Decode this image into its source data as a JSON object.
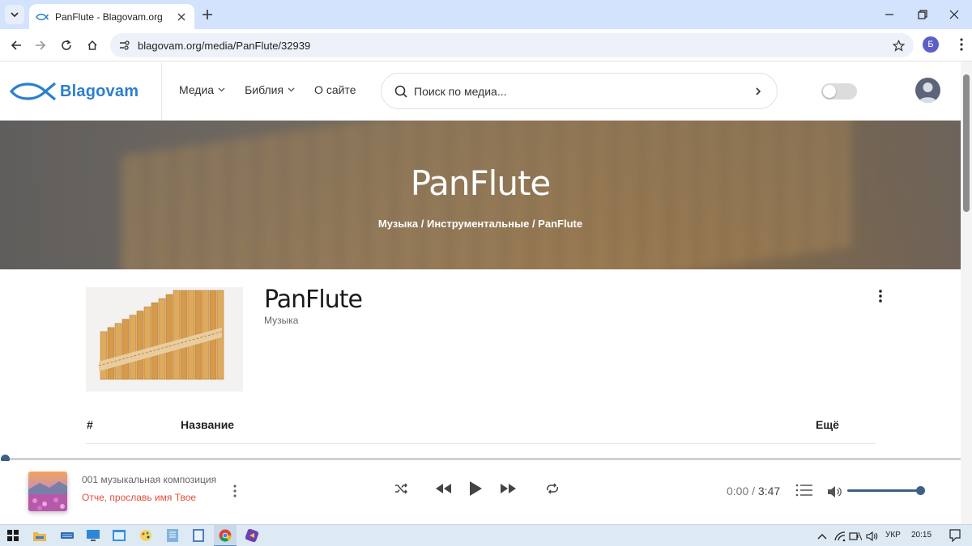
{
  "browser": {
    "tab_title": "PanFlute - Blagovam.org",
    "url": "blagovam.org/media/PanFlute/32939",
    "profile_initial": "Б"
  },
  "site": {
    "logo_text": "Blagovam",
    "nav": [
      {
        "label": "Медиа",
        "has_dropdown": true
      },
      {
        "label": "Библия",
        "has_dropdown": true
      },
      {
        "label": "О сайте",
        "has_dropdown": false
      }
    ],
    "search_placeholder": "Поиск по медиа...",
    "theme_toggle_on": false
  },
  "hero": {
    "title": "PanFlute",
    "breadcrumb": [
      "Музыка",
      "Инструментальные",
      "PanFlute"
    ],
    "breadcrumb_sep": " / "
  },
  "album": {
    "title": "PanFlute",
    "category": "Музыка"
  },
  "table": {
    "headers": {
      "num": "#",
      "name": "Название",
      "more": "Ещё"
    }
  },
  "player": {
    "track_title": "001 музыкальная композиция",
    "track_artist": "Отче, прославь имя Твое",
    "current_time": "0:00",
    "time_sep": " / ",
    "duration": "3:47",
    "progress_fraction": 0,
    "volume_fraction": 1.0,
    "accent_color": "#3e5f86",
    "artist_color": "#e74c3c"
  },
  "taskbar": {
    "language": "УКР",
    "clock": "20:15"
  },
  "colors": {
    "brand_blue": "#2a7fcf",
    "tab_strip": "#d3e3fd"
  }
}
